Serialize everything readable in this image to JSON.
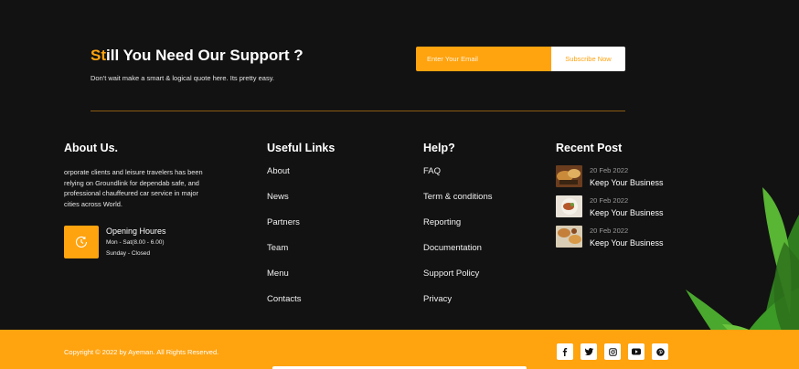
{
  "support": {
    "title_highlight": "St",
    "title_rest": "ill You Need Our Support ?",
    "subtitle": "Don't wait make a smart & logical quote here. Its pretty easy.",
    "email_placeholder": "Enter Your Email",
    "subscribe_label": "Subscribe Now"
  },
  "about": {
    "title": "About Us.",
    "text": "orporate clients and leisure travelers has been relying on Groundlink for dependab safe, and professional chauffeured car service in major cities across World.",
    "hours_title": "Opening Houres",
    "hours_line1": "Mon - Sat(8.00 - 6.00)",
    "hours_line2": "Sunday - Closed",
    "hours_icon": "clock-icon"
  },
  "useful_links": {
    "title": "Useful Links",
    "items": [
      "About",
      "News",
      "Partners",
      "Team",
      "Menu",
      "Contacts"
    ]
  },
  "help": {
    "title": "Help?",
    "items": [
      "FAQ",
      "Term & conditions",
      "Reporting",
      "Documentation",
      "Support Policy",
      "Privacy"
    ]
  },
  "recent_posts": {
    "title": "Recent Post",
    "items": [
      {
        "date": "20 Feb 2022",
        "title": "Keep Your Business"
      },
      {
        "date": "20 Feb 2022",
        "title": "Keep Your Business"
      },
      {
        "date": "20 Feb 2022",
        "title": "Keep Your Business"
      }
    ]
  },
  "footer": {
    "copyright": "Copyright © 2022 by Ayeman. All Rights Reserved.",
    "socials": [
      "facebook-icon",
      "twitter-icon",
      "instagram-icon",
      "youtube-icon",
      "pinterest-icon"
    ]
  },
  "colors": {
    "accent": "#FFA30F",
    "background": "#121212",
    "divider": "#8a5a12"
  }
}
